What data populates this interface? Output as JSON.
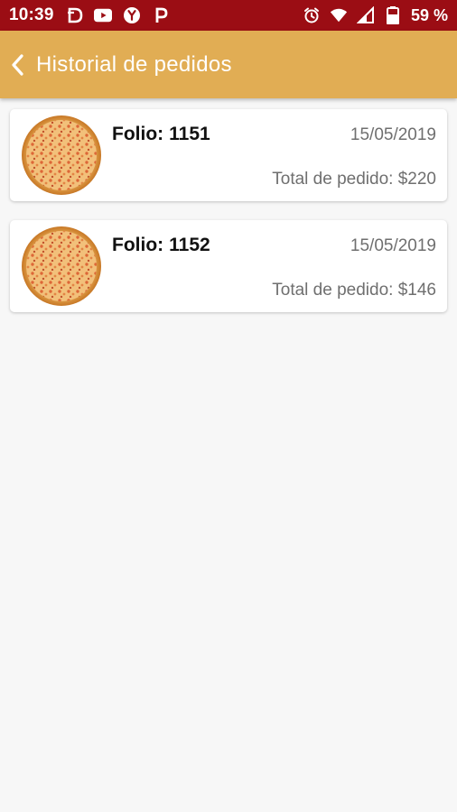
{
  "status_bar": {
    "time": "10:39",
    "notification_icons": [
      "d-icon",
      "youtube-icon",
      "y-icon",
      "p-icon"
    ],
    "alarm_icon": "alarm-icon",
    "wifi_icon": "wifi-icon",
    "signal_icon": "signal-icon",
    "battery_icon": "battery-icon",
    "battery_text": "59 %",
    "colors": {
      "background": "#9b0d14",
      "foreground": "#ffffff"
    }
  },
  "header": {
    "back_icon": "chevron-left-icon",
    "title": "Historial de pedidos",
    "colors": {
      "background": "#e1ad54",
      "foreground": "#ffffff"
    }
  },
  "orders": [
    {
      "folio_label": "Folio:",
      "folio_value": "1151",
      "date": "15/05/2019",
      "total_label": "Total de pedido:",
      "total_value": "$220",
      "image_icon": "pizza-icon"
    },
    {
      "folio_label": "Folio:",
      "folio_value": "1152",
      "date": "15/05/2019",
      "total_label": "Total de pedido:",
      "total_value": "$146",
      "image_icon": "pizza-icon"
    }
  ],
  "colors": {
    "page_background": "#f7f7f7",
    "card_background": "#ffffff",
    "secondary_text": "#6f6f6f",
    "primary_text": "#111111"
  }
}
